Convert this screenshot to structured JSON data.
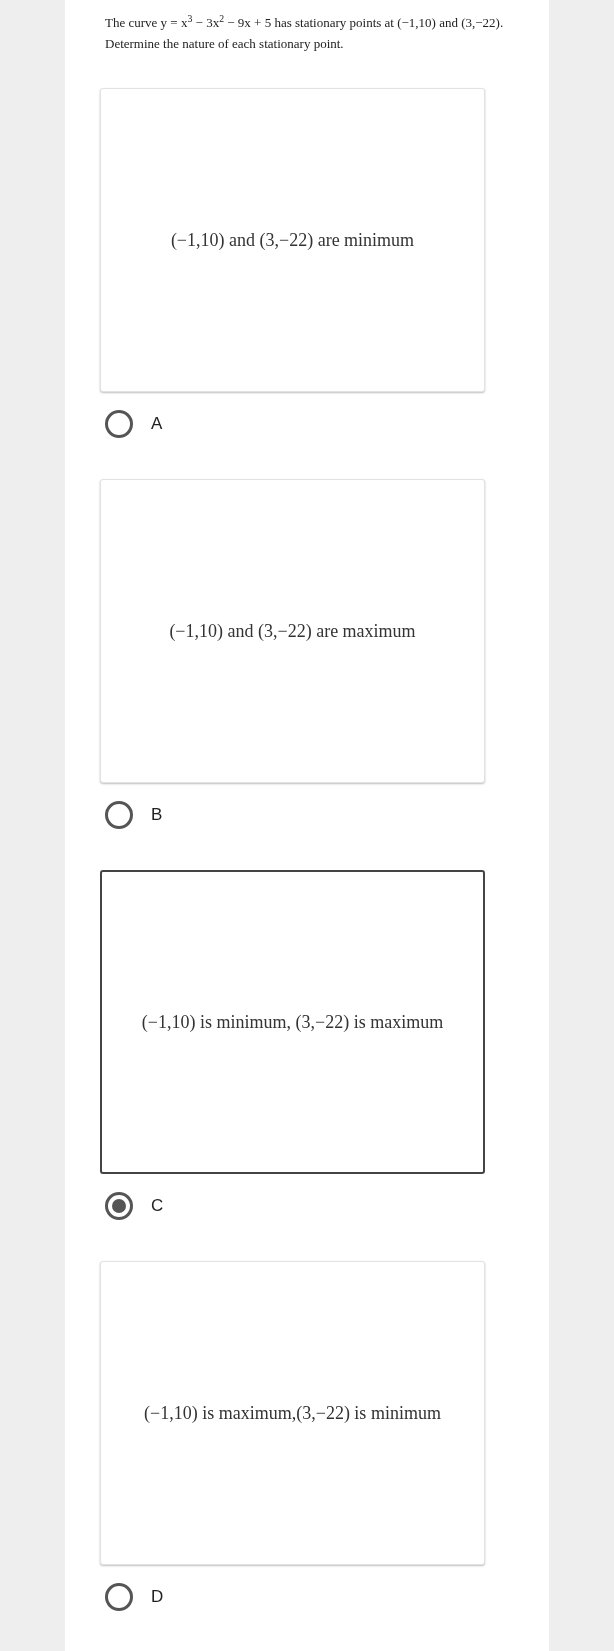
{
  "question": {
    "lines": [
      "The curve y = x$^{3}$ − 3x$^{2}$ − 9x + 5 has stationary points at (−1,10) and (3,−22).",
      "Determine the nature of each stationary point."
    ]
  },
  "options": [
    {
      "text": "(−1,10) and (3,−22) are minimum",
      "label": "A",
      "selected": false
    },
    {
      "text": "(−1,10) and (3,−22) are maximum",
      "label": "B",
      "selected": false
    },
    {
      "text": "(−1,10) is minimum, (3,−22) is maximum",
      "label": "C",
      "selected": true
    },
    {
      "text": "(−1,10) is maximum,(3,−22) is minimum",
      "label": "D",
      "selected": false
    }
  ]
}
